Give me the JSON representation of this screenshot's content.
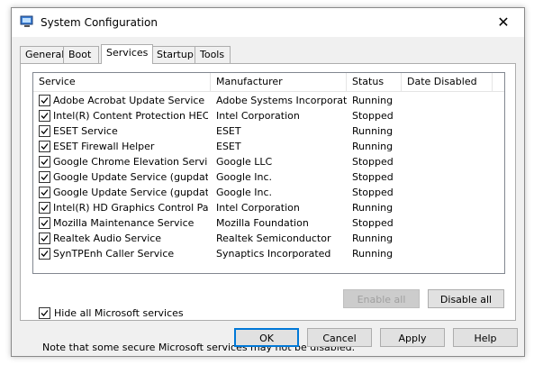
{
  "window": {
    "title": "System Configuration",
    "close_glyph": "✕"
  },
  "tabs": [
    {
      "label": "General"
    },
    {
      "label": "Boot"
    },
    {
      "label": "Services",
      "active": true
    },
    {
      "label": "Startup"
    },
    {
      "label": "Tools"
    }
  ],
  "columns": {
    "service": "Service",
    "manufacturer": "Manufacturer",
    "status": "Status",
    "date_disabled": "Date Disabled"
  },
  "services": [
    {
      "checked": true,
      "service": "Adobe Acrobat Update Service",
      "manufacturer": "Adobe Systems Incorporated",
      "status": "Running",
      "date_disabled": ""
    },
    {
      "checked": true,
      "service": "Intel(R) Content Protection HEC...",
      "manufacturer": "Intel Corporation",
      "status": "Stopped",
      "date_disabled": ""
    },
    {
      "checked": true,
      "service": "ESET Service",
      "manufacturer": "ESET",
      "status": "Running",
      "date_disabled": ""
    },
    {
      "checked": true,
      "service": "ESET Firewall Helper",
      "manufacturer": "ESET",
      "status": "Running",
      "date_disabled": ""
    },
    {
      "checked": true,
      "service": "Google Chrome Elevation Servic...",
      "manufacturer": "Google LLC",
      "status": "Stopped",
      "date_disabled": ""
    },
    {
      "checked": true,
      "service": "Google Update Service (gupdate)",
      "manufacturer": "Google Inc.",
      "status": "Stopped",
      "date_disabled": ""
    },
    {
      "checked": true,
      "service": "Google Update Service (gupdatem)",
      "manufacturer": "Google Inc.",
      "status": "Stopped",
      "date_disabled": ""
    },
    {
      "checked": true,
      "service": "Intel(R) HD Graphics Control Pa...",
      "manufacturer": "Intel Corporation",
      "status": "Running",
      "date_disabled": ""
    },
    {
      "checked": true,
      "service": "Mozilla Maintenance Service",
      "manufacturer": "Mozilla Foundation",
      "status": "Stopped",
      "date_disabled": ""
    },
    {
      "checked": true,
      "service": "Realtek Audio Service",
      "manufacturer": "Realtek Semiconductor",
      "status": "Running",
      "date_disabled": ""
    },
    {
      "checked": true,
      "service": "SynTPEnh Caller Service",
      "manufacturer": "Synaptics Incorporated",
      "status": "Running",
      "date_disabled": ""
    }
  ],
  "note": "Note that some secure Microsoft services may not be disabled.",
  "buttons": {
    "enable_all": "Enable all",
    "disable_all": "Disable all",
    "ok": "OK",
    "cancel": "Cancel",
    "apply": "Apply",
    "help": "Help"
  },
  "hide_microsoft": {
    "checked": true,
    "label": "Hide all Microsoft services"
  },
  "colors": {
    "accent": "#0078d7",
    "disabled_text": "#a0a0a0"
  },
  "icons": {
    "app": "system-config-icon",
    "close": "close-icon",
    "check": "checkmark-icon"
  }
}
